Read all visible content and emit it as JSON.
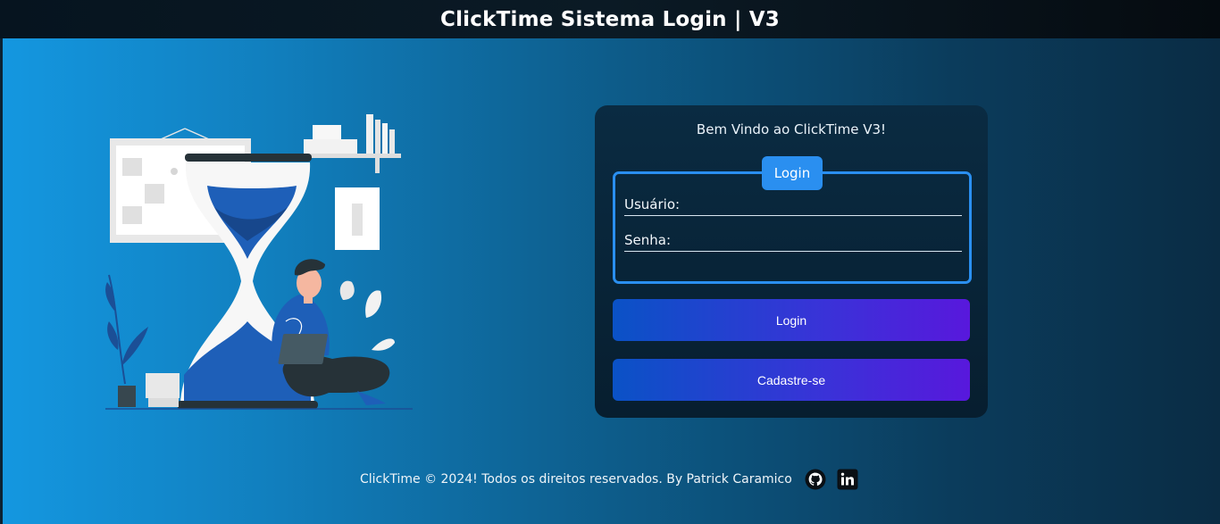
{
  "header": {
    "title": "ClickTime Sistema Login | V3"
  },
  "card": {
    "welcome": "Bem Vindo ao ClickTime V3!",
    "legend": "Login",
    "fields": {
      "username_label": "Usuário:",
      "password_label": "Senha:"
    },
    "buttons": {
      "login": "Login",
      "register": "Cadastre-se"
    }
  },
  "footer": {
    "text": "ClickTime © 2024! Todos os direitos reservados. By Patrick Caramico",
    "icons": [
      "github-icon",
      "linkedin-icon"
    ]
  },
  "colors": {
    "accent": "#2a8ff0",
    "button_gradient_start": "#0a52c6",
    "button_gradient_end": "#5818dc",
    "illustration_blue": "#1e5fb8"
  }
}
